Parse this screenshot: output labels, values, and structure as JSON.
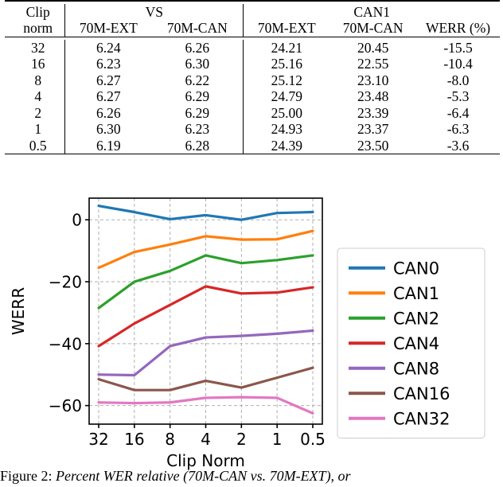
{
  "table": {
    "group_headers": [
      {
        "label": "",
        "span": 1
      },
      {
        "label": "VS",
        "span": 2
      },
      {
        "label": "CAN1",
        "span": 3
      }
    ],
    "columns": [
      "Clip norm",
      "70M-EXT",
      "70M-CAN",
      "70M-EXT",
      "70M-CAN",
      "WERR (%)"
    ],
    "column_line1": [
      "Clip",
      "",
      "VS",
      "",
      "CAN1",
      ""
    ],
    "column_line2": [
      "norm",
      "70M-EXT",
      "70M-CAN",
      "70M-EXT",
      "70M-CAN",
      "WERR (%)"
    ],
    "rows": [
      {
        "clip_norm": "32",
        "vs_ext": "6.24",
        "vs_can": "6.26",
        "can1_ext": "24.21",
        "can1_can": "20.45",
        "werr": "-15.5",
        "werr_bold": false
      },
      {
        "clip_norm": "16",
        "vs_ext": "6.23",
        "vs_can": "6.30",
        "can1_ext": "25.16",
        "can1_can": "22.55",
        "werr": "-10.4",
        "werr_bold": false
      },
      {
        "clip_norm": "8",
        "vs_ext": "6.27",
        "vs_can": "6.22",
        "can1_ext": "25.12",
        "can1_can": "23.10",
        "werr": "-8.0",
        "werr_bold": false
      },
      {
        "clip_norm": "4",
        "vs_ext": "6.27",
        "vs_can": "6.29",
        "can1_ext": "24.79",
        "can1_can": "23.48",
        "werr": "-5.3",
        "werr_bold": false
      },
      {
        "clip_norm": "2",
        "vs_ext": "6.26",
        "vs_can": "6.29",
        "can1_ext": "25.00",
        "can1_can": "23.39",
        "werr": "-6.4",
        "werr_bold": false
      },
      {
        "clip_norm": "1",
        "vs_ext": "6.30",
        "vs_can": "6.23",
        "can1_ext": "24.93",
        "can1_can": "23.37",
        "werr": "-6.3",
        "werr_bold": false
      },
      {
        "clip_norm": "0.5",
        "vs_ext": "6.19",
        "vs_can": "6.28",
        "can1_ext": "24.39",
        "can1_can": "23.50",
        "werr": "-3.6",
        "werr_bold": true
      }
    ]
  },
  "caption": {
    "label": "Figure 2:",
    "text": "Percent WER relative (70M-CAN vs. 70M-EXT), or"
  },
  "chart_data": {
    "type": "line",
    "title": "",
    "xlabel": "Clip Norm",
    "ylabel": "WERR",
    "categories": [
      "32",
      "16",
      "8",
      "4",
      "2",
      "1",
      "0.5"
    ],
    "x_tick_labels": [
      "32",
      "16",
      "8",
      "4",
      "2",
      "1",
      "0.5"
    ],
    "y_tick_labels": [
      "0",
      "−20",
      "−40",
      "−60"
    ],
    "y_ticks": [
      0,
      -20,
      -40,
      -60
    ],
    "ylim": [
      -66,
      7
    ],
    "grid": true,
    "legend_position": "right-outside",
    "series": [
      {
        "name": "CAN0",
        "color": "#1f77b4",
        "values": [
          4.5,
          2.5,
          0.2,
          1.5,
          0.0,
          2.2,
          2.5
        ]
      },
      {
        "name": "CAN1",
        "color": "#ff7f0e",
        "values": [
          -15.5,
          -10.4,
          -8.0,
          -5.3,
          -6.4,
          -6.3,
          -3.6
        ]
      },
      {
        "name": "CAN2",
        "color": "#2ca02c",
        "values": [
          -28.5,
          -20.0,
          -16.5,
          -11.5,
          -14.0,
          -13.0,
          -11.5
        ]
      },
      {
        "name": "CAN4",
        "color": "#d62728",
        "values": [
          -40.8,
          -33.5,
          -27.5,
          -21.5,
          -23.8,
          -23.5,
          -21.8
        ]
      },
      {
        "name": "CAN8",
        "color": "#9467bd",
        "values": [
          -50.0,
          -50.2,
          -40.8,
          -38.0,
          -37.5,
          -36.8,
          -35.8
        ]
      },
      {
        "name": "CAN16",
        "color": "#8c564b",
        "values": [
          -51.5,
          -55.0,
          -55.0,
          -52.0,
          -54.2,
          -51.0,
          -47.8
        ]
      },
      {
        "name": "CAN32",
        "color": "#e377c2",
        "values": [
          -59.0,
          -59.2,
          -59.0,
          -57.5,
          -57.3,
          -57.5,
          -62.5
        ]
      }
    ]
  }
}
